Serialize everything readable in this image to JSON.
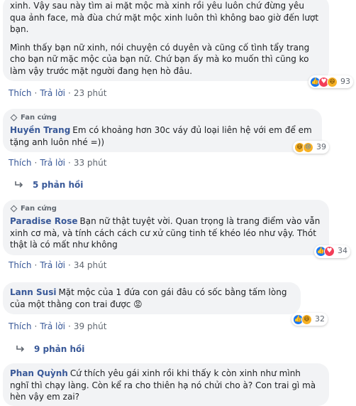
{
  "comments": [
    {
      "author": "",
      "badge": "",
      "paragraphs": [
        "xinh. Vậy sau này tìm ai mặt mộc mà xinh rồi yêu luôn chứ đừng yêu qua ảnh face, mà đùa chứ mặt mộc xinh luôn thì không bao giờ đến lượt bạn.",
        "Mình thấy bạn nữ xinh, nói chuyện có duyên và cũng cố tình tẩy trang cho bạn nữ mặc mộc của bạn nữ. Chứ bạn ấy mà ko muốn thì cũng ko làm vậy trước mặt người đang hẹn hò đâu."
      ],
      "reactions": [
        "like",
        "love",
        "haha"
      ],
      "reaction_count": "93",
      "like_label": "Thích",
      "reply_label": "Trả lời",
      "time": "23 phút",
      "replies_label": ""
    },
    {
      "author": "Huyền Trang",
      "badge": "Fan cứng",
      "paragraphs": [
        "Em có khoảng hơn 30c váy đủ loại liên hệ với em để em tặng anh luôn nhé =))"
      ],
      "reactions": [
        "haha",
        "sad"
      ],
      "reaction_count": "39",
      "like_label": "Thích",
      "reply_label": "Trả lời",
      "time": "33 phút",
      "replies_label": "5 phản hồi"
    },
    {
      "author": "Paradise Rose",
      "badge": "Fan cứng",
      "paragraphs": [
        "Bạn nữ thật tuyệt vời. Quan trọng là trang điểm vào vẫn xinh cơ mà, và tính cách cách cư xử cũng tinh tế khéo léo như vậy. Thót thật là có mất như không"
      ],
      "reactions": [
        "like",
        "love"
      ],
      "reaction_count": "34",
      "like_label": "Thích",
      "reply_label": "Trả lời",
      "time": "34 phút",
      "replies_label": ""
    },
    {
      "author": "Lann Susi",
      "badge": "",
      "paragraphs": [
        "Mặt mộc của 1 đứa con gái đâu có sốc bằng tấm lòng của một thằng con trai được 😡"
      ],
      "reactions": [
        "like",
        "haha"
      ],
      "reaction_count": "32",
      "like_label": "Thích",
      "reply_label": "Trả lời",
      "time": "39 phút",
      "replies_label": "9 phản hồi"
    },
    {
      "author": "Phan Quỳnh",
      "badge": "",
      "paragraphs": [
        "Cứ thích yêu gái xinh rồi khi thấy k còn xinh như mình nghĩ thì chạy làng. Còn kể ra cho thiên hạ nó chửi cho à? Con trai gì mà hèn vậy em zai?"
      ],
      "reactions": [],
      "reaction_count": "",
      "like_label": "",
      "reply_label": "",
      "time": "",
      "replies_label": ""
    }
  ],
  "colors": {
    "bubble": "#f2f3f5",
    "link": "#385898",
    "meta": "#606770",
    "like": "#1877f2",
    "love": "#f33e58",
    "haha": "#f7b125"
  }
}
